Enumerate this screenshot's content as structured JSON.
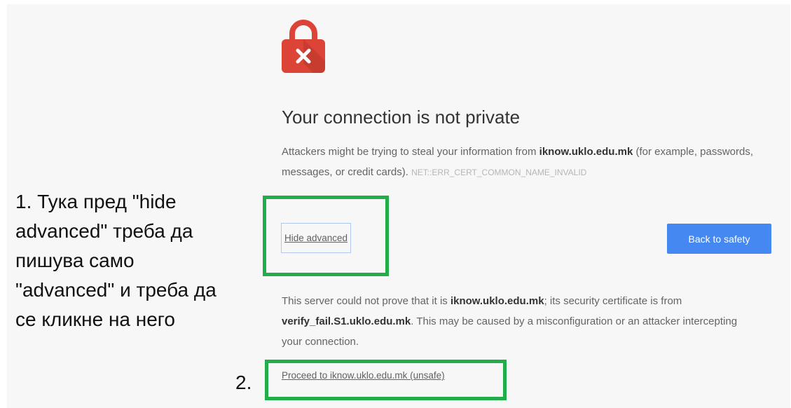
{
  "error_page": {
    "title": "Your connection is not private",
    "intro": {
      "before_host": "Attackers might be trying to steal your information from ",
      "host": "iknow.uklo.edu.mk",
      "after_host": " (for example, passwords, messages, or credit cards). ",
      "error_code": "NET::ERR_CERT_COMMON_NAME_INVALID"
    },
    "hide_advanced_label": "Hide advanced",
    "back_button_label": "Back to safety",
    "details": {
      "before_host": "This server could not prove that it is ",
      "host": "iknow.uklo.edu.mk",
      "middle": "; its security certificate is from ",
      "issuer": "verify_fail.S1.uklo.edu.mk",
      "after_issuer": ". This may be caused by a misconfiguration or an attacker intercepting your connection."
    },
    "proceed_link": "Proceed to iknow.uklo.edu.mk (unsafe)",
    "icon": "lock-error-icon",
    "colors": {
      "lock": "#db4437",
      "button": "#4688f1",
      "annotation": "#22ad4b"
    }
  },
  "annotations": {
    "note_lines": [
      "1. Тука пред \"hide",
      "advanced\" треба да",
      "пишува само",
      "\"advanced\" и треба да",
      "се кликне на него"
    ],
    "step2_label": "2."
  }
}
